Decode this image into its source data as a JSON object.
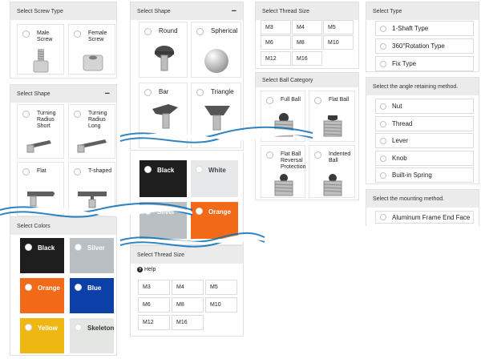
{
  "screw_type": {
    "header": "Select Screw Type",
    "options": [
      {
        "label": "Male\nScrew",
        "icon": "male-screw-icon"
      },
      {
        "label": "Female\nScrew",
        "icon": "female-screw-icon"
      }
    ]
  },
  "shape_left": {
    "header": "Select Shape",
    "collapse_symbol": "−",
    "options": [
      {
        "label": "Turning\nRadius\nShort",
        "icon": "short-lever-icon"
      },
      {
        "label": "Turning\nRadius\nLong",
        "icon": "long-lever-icon"
      },
      {
        "label": "Flat",
        "icon": "flat-lever-icon"
      },
      {
        "label": "T-shaped",
        "icon": "t-handle-icon"
      }
    ]
  },
  "colors_left": {
    "header": "Select Colors",
    "options": [
      {
        "label": "Black",
        "color": "#1e1e1e"
      },
      {
        "label": "Silver",
        "color": "#b9bfc2"
      },
      {
        "label": "Orange",
        "color": "#f26a18"
      },
      {
        "label": "Blue",
        "color": "#0c3fa8"
      },
      {
        "label": "Yellow",
        "color": "#efb712"
      },
      {
        "label": "Skeleton",
        "color": "#e4e6e4"
      }
    ]
  },
  "shape_mid": {
    "header": "Select Shape",
    "collapse_symbol": "−",
    "options": [
      {
        "label": "Round",
        "icon": "round-knob-icon"
      },
      {
        "label": "Spherical",
        "icon": "sphere-icon"
      },
      {
        "label": "Bar",
        "icon": "bar-knob-icon"
      },
      {
        "label": "Triangle",
        "icon": "triangle-knob-icon"
      }
    ]
  },
  "colors_mid": {
    "options": [
      {
        "label": "Black",
        "color": "#1e1e1e"
      },
      {
        "label": "White",
        "color": "#e6e8e9"
      },
      {
        "label": "Silver",
        "color": "#b9bfc2"
      },
      {
        "label": "Orange",
        "color": "#f26a18"
      }
    ]
  },
  "thread_mid": {
    "header": "Select Thread Size",
    "help_label": "Help",
    "sizes": [
      "M3",
      "M4",
      "M5",
      "M6",
      "M8",
      "M10",
      "M12",
      "M16"
    ]
  },
  "thread_top": {
    "header": "Select Thread Size",
    "sizes": [
      "M3",
      "M4",
      "M5",
      "M6",
      "M8",
      "M10",
      "M12",
      "M16"
    ]
  },
  "ball": {
    "header": "Select Ball Category",
    "options": [
      {
        "label": "Full Ball",
        "icon": "full-ball-plunger-icon"
      },
      {
        "label": "Flat Ball",
        "icon": "flat-ball-plunger-icon"
      },
      {
        "label": "Flat Ball\nReversal\nProtection",
        "icon": "flat-ball-reversal-icon"
      },
      {
        "label": "Indented\nBall",
        "icon": "indented-ball-icon"
      }
    ]
  },
  "type": {
    "header": "Select Type",
    "options": [
      "1-Shaft Type",
      "360°Rotation Type",
      "Fix Type"
    ]
  },
  "angle": {
    "header": "Select the angle retaining method.",
    "options": [
      "Nut",
      "Thread",
      "Lever",
      "Knob",
      "Built-in Spring"
    ]
  },
  "mounting": {
    "header": "Select the mounting method.",
    "options": [
      "Aluminum Frame End Face"
    ]
  },
  "accent": {
    "wave_color": "#0a6fb8",
    "panel_header_bg": "#ebebeb"
  }
}
